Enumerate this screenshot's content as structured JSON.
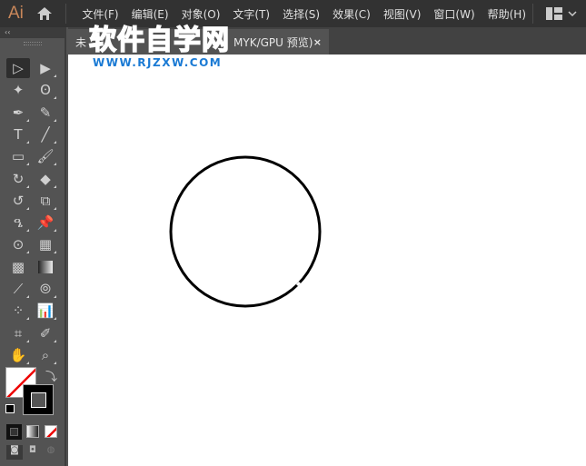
{
  "app": {
    "logo": "Ai"
  },
  "menu": [
    "文件(F)",
    "编辑(E)",
    "对象(O)",
    "文字(T)",
    "选择(S)",
    "效果(C)",
    "视图(V)",
    "窗口(W)",
    "帮助(H)"
  ],
  "toolbar": {
    "collapse": "‹‹"
  },
  "document_tab": {
    "title_start": "未",
    "title_end": "MYK/GPU 预览)",
    "close": "×"
  },
  "watermark": {
    "name": "软件自学网",
    "url": "WWW.RJZXW.COM"
  },
  "colors": {
    "accent": "#c9875a",
    "watermark": "#1a7ad4",
    "stroke": "#000000"
  },
  "tools": [
    [
      "selection",
      "direct-selection"
    ],
    [
      "magic-wand",
      "lasso"
    ],
    [
      "pen",
      "curvature"
    ],
    [
      "type",
      "line-segment"
    ],
    [
      "rectangle",
      "paintbrush"
    ],
    [
      "shaper",
      "eraser"
    ],
    [
      "rotate",
      "scale"
    ],
    [
      "warp",
      "puppet-warp"
    ],
    [
      "shape-builder",
      "perspective-grid"
    ],
    [
      "mesh",
      "gradient"
    ],
    [
      "eyedropper",
      "blend"
    ],
    [
      "symbol-sprayer",
      "column-graph"
    ],
    [
      "artboard",
      "slice"
    ],
    [
      "hand",
      "zoom"
    ]
  ]
}
